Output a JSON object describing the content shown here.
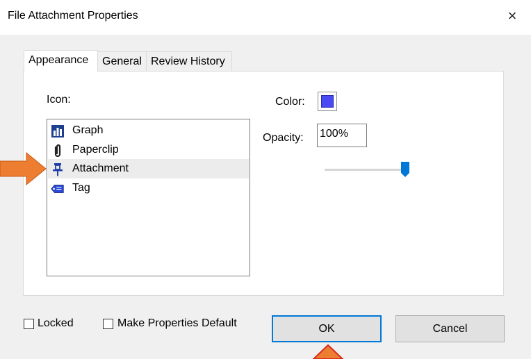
{
  "window": {
    "title": "File Attachment Properties",
    "close_label": "×"
  },
  "tabs": [
    {
      "label": "Appearance",
      "active": true
    },
    {
      "label": "General",
      "active": false
    },
    {
      "label": "Review History",
      "active": false
    }
  ],
  "appearance": {
    "icon_label": "Icon:",
    "icons": [
      {
        "label": "Graph",
        "icon": "graph-icon",
        "selected": false
      },
      {
        "label": "Paperclip",
        "icon": "paperclip-icon",
        "selected": false
      },
      {
        "label": "Attachment",
        "icon": "pushpin-icon",
        "selected": true
      },
      {
        "label": "Tag",
        "icon": "tag-icon",
        "selected": false
      }
    ],
    "color_label": "Color:",
    "color_value": "#4a4af4",
    "opacity_label": "Opacity:",
    "opacity_value": "100%",
    "opacity_level": 1.0
  },
  "footer": {
    "locked_label": "Locked",
    "locked_checked": false,
    "default_label": "Make Properties Default",
    "default_checked": false,
    "ok_label": "OK",
    "cancel_label": "Cancel"
  },
  "colors": {
    "accent": "#0078d7",
    "annotation_arrow": "#ed7d31"
  }
}
